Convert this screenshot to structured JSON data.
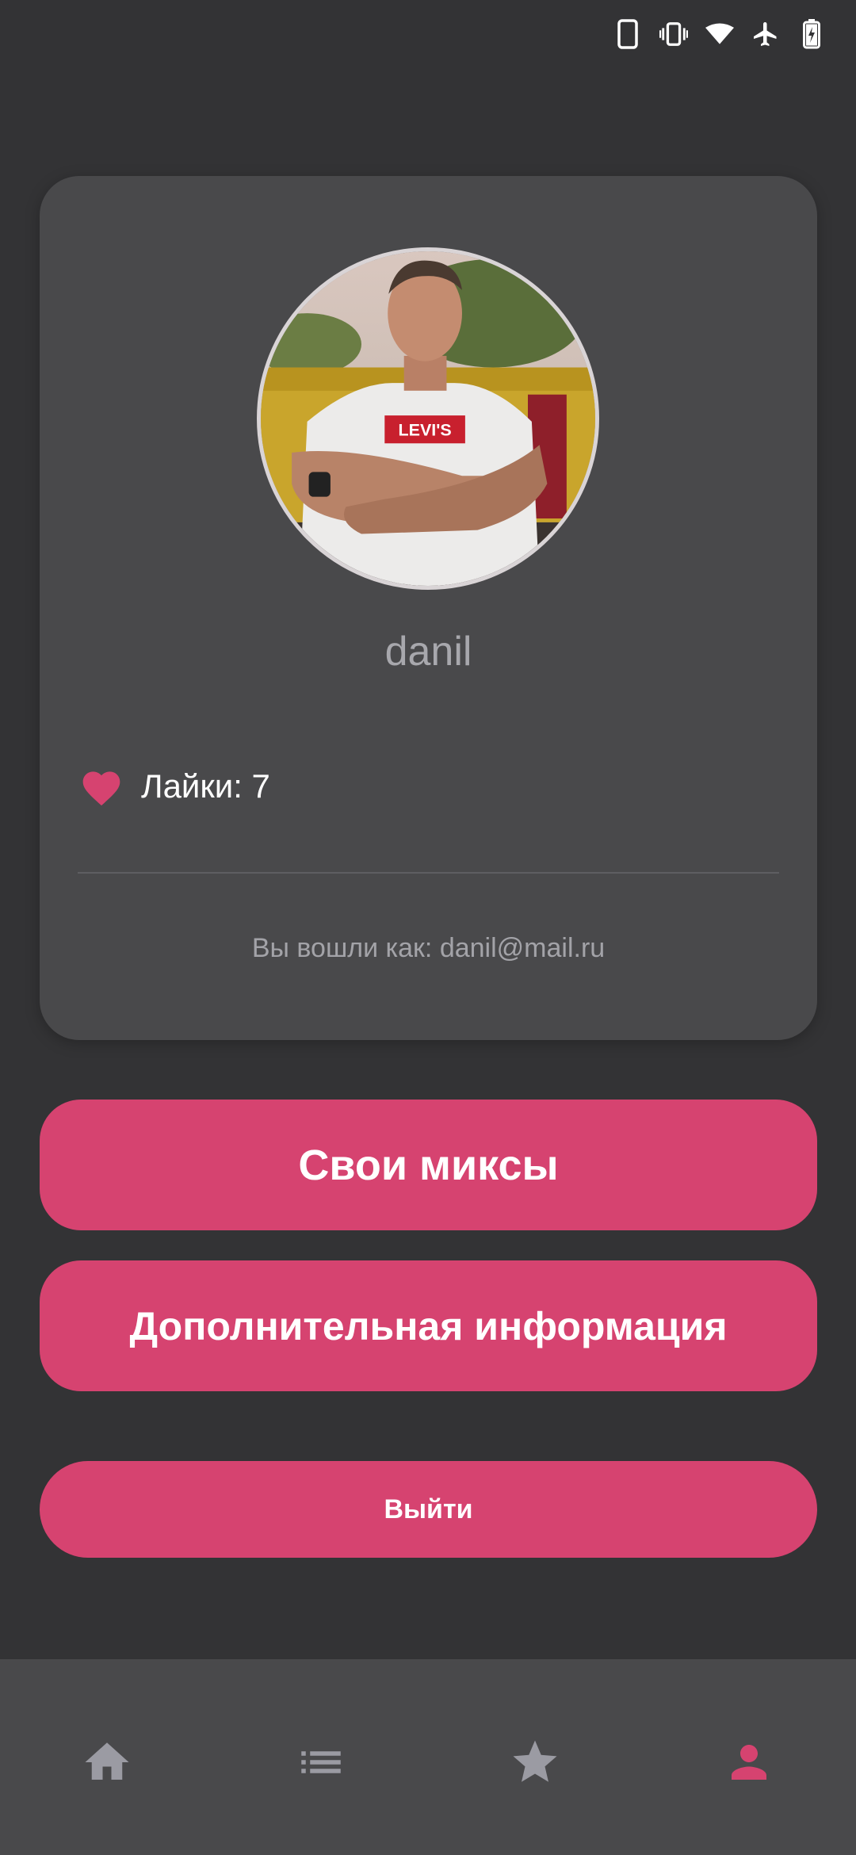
{
  "profile": {
    "username": "danil",
    "likes_label": "Лайки: 7",
    "login_info": "Вы вошли как: danil@mail.ru"
  },
  "buttons": {
    "my_mixes": "Свои миксы",
    "additional_info": "Дополнительная информация",
    "logout": "Выйти"
  },
  "nav": {
    "items": [
      {
        "icon": "home-icon",
        "active": false
      },
      {
        "icon": "list-icon",
        "active": false
      },
      {
        "icon": "star-icon",
        "active": false
      },
      {
        "icon": "person-icon",
        "active": true
      }
    ]
  },
  "colors": {
    "background": "#333335",
    "card": "#49494b",
    "accent": "#d64370",
    "nav_inactive": "#9b9ba3"
  },
  "status_bar": {
    "icons": [
      "phone-icon",
      "vibrate-icon",
      "wifi-icon",
      "airplane-icon",
      "battery-charging-icon"
    ]
  }
}
